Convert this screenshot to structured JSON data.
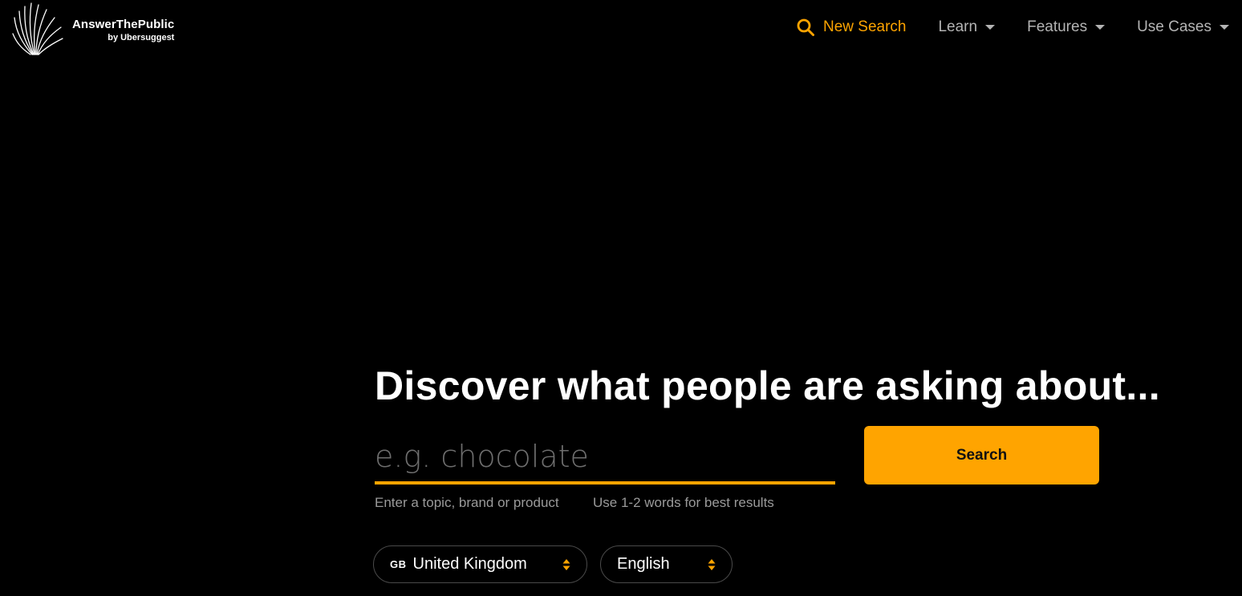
{
  "brand": {
    "title": "AnswerThePublic",
    "subtitle": "by Ubersuggest",
    "logo_icon": "sparkle-lines-logo"
  },
  "nav": {
    "new_search": "New Search",
    "learn": "Learn",
    "features": "Features",
    "use_cases": "Use Cases"
  },
  "hero": {
    "headline": "Discover what people are asking about...",
    "search_placeholder": "e.g. chocolate",
    "search_value": "",
    "search_button": "Search",
    "hint_topic": "Enter a topic, brand or product",
    "hint_words": "Use 1-2 words for best results"
  },
  "filters": {
    "country_code": "GB",
    "country": "United Kingdom",
    "language": "English"
  },
  "colors": {
    "background": "#000000",
    "accent": "#ffa400",
    "nav_text": "#b4b4b4",
    "hint_text": "#9a9a9a"
  }
}
